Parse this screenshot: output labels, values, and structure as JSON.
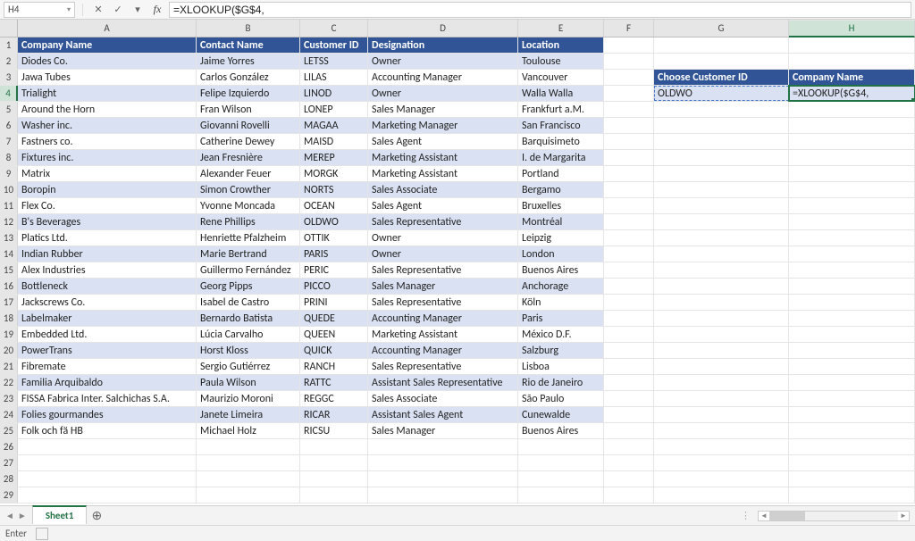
{
  "namebox": "H4",
  "formula": "=XLOOKUP($G$4,",
  "columns": [
    "A",
    "B",
    "C",
    "D",
    "E",
    "F",
    "G",
    "H"
  ],
  "active_cell": {
    "row": 4,
    "col": 8
  },
  "table": {
    "headers": [
      "Company Name",
      "Contact Name",
      "Customer ID",
      "Designation",
      "Location"
    ],
    "rows": [
      [
        "Diodes Co.",
        "Jaime Yorres",
        "LETSS",
        "Owner",
        "Toulouse"
      ],
      [
        "Jawa Tubes",
        "Carlos González",
        "LILAS",
        "Accounting Manager",
        "Vancouver"
      ],
      [
        "Trialight",
        "Felipe Izquierdo",
        "LINOD",
        "Owner",
        "Walla Walla"
      ],
      [
        "Around the Horn",
        "Fran Wilson",
        "LONEP",
        "Sales Manager",
        "Frankfurt a.M."
      ],
      [
        "Washer inc.",
        "Giovanni Rovelli",
        "MAGAA",
        "Marketing Manager",
        "San Francisco"
      ],
      [
        "Fastners co.",
        "Catherine Dewey",
        "MAISD",
        "Sales Agent",
        "Barquisimeto"
      ],
      [
        "Fixtures inc.",
        "Jean Fresnière",
        "MEREP",
        "Marketing Assistant",
        "I. de Margarita"
      ],
      [
        "Matrix",
        "Alexander Feuer",
        "MORGK",
        "Marketing Assistant",
        "Portland"
      ],
      [
        "Boropin",
        "Simon Crowther",
        "NORTS",
        "Sales Associate",
        "Bergamo"
      ],
      [
        "Flex Co.",
        "Yvonne Moncada",
        "OCEAN",
        "Sales Agent",
        "Bruxelles"
      ],
      [
        "B's Beverages",
        "Rene Phillips",
        "OLDWO",
        "Sales Representative",
        "Montréal"
      ],
      [
        "Platics Ltd.",
        "Henriette Pfalzheim",
        "OTTIK",
        "Owner",
        "Leipzig"
      ],
      [
        "Indian Rubber",
        "Marie Bertrand",
        "PARIS",
        "Owner",
        "London"
      ],
      [
        "Alex Industries",
        "Guillermo Fernández",
        "PERIC",
        "Sales Representative",
        "Buenos Aires"
      ],
      [
        "Bottleneck",
        "Georg Pipps",
        "PICCO",
        "Sales Manager",
        "Anchorage"
      ],
      [
        "Jackscrews Co.",
        "Isabel de Castro",
        "PRINI",
        "Sales Representative",
        "Köln"
      ],
      [
        "Labelmaker",
        "Bernardo Batista",
        "QUEDE",
        "Accounting Manager",
        "Paris"
      ],
      [
        "Embedded Ltd.",
        "Lúcia Carvalho",
        "QUEEN",
        "Marketing Assistant",
        "México D.F."
      ],
      [
        "PowerTrans",
        "Horst Kloss",
        "QUICK",
        "Accounting Manager",
        "Salzburg"
      ],
      [
        "Fibremate",
        "Sergio Gutiérrez",
        "RANCH",
        "Sales Representative",
        "Lisboa"
      ],
      [
        "Familia Arquibaldo",
        "Paula Wilson",
        "RATTC",
        "Assistant Sales Representative",
        "Rio de Janeiro"
      ],
      [
        "FISSA Fabrica Inter. Salchichas S.A.",
        "Maurizio Moroni",
        "REGGC",
        "Sales Associate",
        "São Paulo"
      ],
      [
        "Folies gourmandes",
        "Janete Limeira",
        "RICAR",
        "Assistant Sales Agent",
        "Cunewalde"
      ],
      [
        "Folk och fä HB",
        "Michael Holz",
        "RICSU",
        "Sales Manager",
        "Buenos Aires"
      ]
    ]
  },
  "side": {
    "header_g": "Choose Customer ID",
    "header_h": "Company Name",
    "value_g": "OLDWO",
    "value_h": "=XLOOKUP($G$4,"
  },
  "sheet_name": "Sheet1",
  "status_mode": "Enter",
  "fb_icons": {
    "cancel": "✕",
    "confirm": "✓",
    "dropdown": "▾"
  },
  "scroll_icons": {
    "left": "◄",
    "right": "►"
  },
  "tab_nav": {
    "left": "◄",
    "right": "►"
  },
  "total_rows": 29
}
